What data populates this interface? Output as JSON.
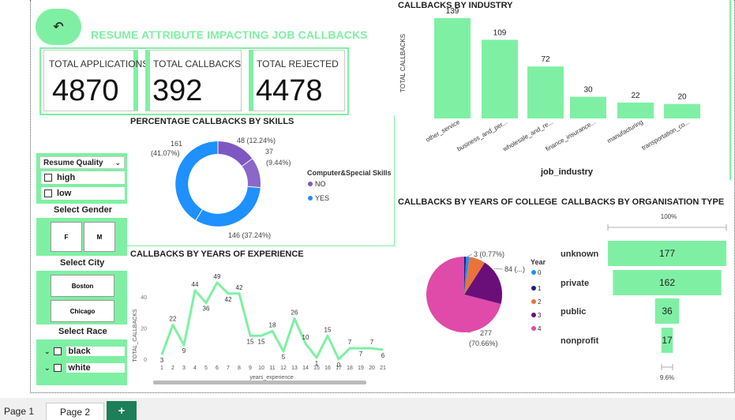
{
  "back_button": {
    "icon": "back-arrow-icon"
  },
  "title": "RESUME ATTRIBUTE IMPACTING JOB  CALLBACKS",
  "kpis": [
    {
      "label": "TOTAL APPLICATIONS",
      "value": "4870"
    },
    {
      "label": "TOTAL CALLBACKS",
      "value": "392"
    },
    {
      "label": "TOTAL REJECTED",
      "value": "4478"
    }
  ],
  "skills_chart": {
    "title": "PERCENTAGE CALLBACKS BY SKILLS",
    "legend_title": "Computer&Special Skills",
    "legend": [
      {
        "name": "NO",
        "color": "#7e57c2"
      },
      {
        "name": "YES",
        "color": "#1e90ff"
      }
    ],
    "labels": [
      "48 (12.24%)",
      "37",
      "(9.44%)",
      "161",
      "(41.07%)",
      "146 (37.24%)"
    ]
  },
  "filters": {
    "resume_quality": {
      "label": "Resume Quality",
      "options": [
        "high",
        "low"
      ]
    },
    "gender": {
      "label": "Select Gender",
      "options": [
        "F",
        "M"
      ]
    },
    "city": {
      "label": "Select City",
      "options": [
        "Boston",
        "Chicago"
      ]
    },
    "race": {
      "label": "Select Race",
      "options": [
        "black",
        "white"
      ]
    }
  },
  "industry_chart": {
    "title": "CALLBACKS BY INDUSTRY",
    "xlabel": "job_industry",
    "ylabel": "TOTAL CALLBACKS"
  },
  "experience_chart": {
    "title": "CALLBACKS BY YEARS OF EXPERIENCE",
    "xlabel": "years_experience",
    "ylabel": "TOTAL_CALLBACKS"
  },
  "college_chart": {
    "title": "CALLBACKS BY YEARS OF COLLEGE",
    "legend_title": "Year",
    "legend": [
      {
        "name": "0",
        "color": "#1e90ff"
      },
      {
        "name": "1",
        "color": "#1a237e"
      },
      {
        "name": "2",
        "color": "#e8743b"
      },
      {
        "name": "3",
        "color": "#6a0f7a"
      },
      {
        "name": "4",
        "color": "#e04aa8"
      }
    ],
    "labels": [
      "3 (0.77%)",
      "84 (...)",
      "277",
      "(70.66%)"
    ]
  },
  "org_chart": {
    "title": "CALLBACKS BY ORGANISATION TYPE",
    "top_label": "100%",
    "bottom_label": "9.6%"
  },
  "chart_data": [
    {
      "type": "bar",
      "title": "CALLBACKS BY INDUSTRY",
      "xlabel": "job_industry",
      "ylabel": "TOTAL CALLBACKS",
      "categories": [
        "other_service",
        "business_and_per...",
        "wholesale_and_re...",
        "finance_insurance...",
        "manufacturing",
        "transportation_co..."
      ],
      "values": [
        139,
        109,
        72,
        30,
        22,
        20
      ],
      "color": "#7ff0a3"
    },
    {
      "type": "line",
      "title": "CALLBACKS BY YEARS OF EXPERIENCE",
      "xlabel": "years_experience",
      "ylabel": "TOTAL_CALLBACKS",
      "x": [
        1,
        2,
        3,
        4,
        5,
        6,
        7,
        8,
        9,
        10,
        11,
        12,
        13,
        14,
        15,
        16,
        17,
        18,
        19,
        20,
        21
      ],
      "y": [
        3,
        22,
        9,
        44,
        36,
        49,
        42,
        42,
        15,
        15,
        18,
        5,
        26,
        10,
        1,
        15,
        0,
        7,
        7,
        7,
        6
      ],
      "yticks": [
        0,
        20,
        40
      ],
      "ylim": [
        0,
        52
      ],
      "color": "#7ff0a3"
    },
    {
      "type": "pie",
      "title": "PERCENTAGE CALLBACKS BY SKILLS",
      "donut": true,
      "series": [
        {
          "name": "NO",
          "values": [
            48,
            37
          ]
        },
        {
          "name": "YES",
          "values": [
            161,
            146
          ]
        }
      ]
    },
    {
      "type": "pie",
      "title": "CALLBACKS BY YEARS OF COLLEGE",
      "categories": [
        "0",
        "2",
        "3",
        "4"
      ],
      "values": [
        3,
        28,
        84,
        277
      ]
    },
    {
      "type": "bar",
      "title": "CALLBACKS BY ORGANISATION TYPE",
      "orientation": "horizontal-funnel",
      "categories": [
        "unknown",
        "private",
        "public",
        "nonprofit"
      ],
      "values": [
        177,
        162,
        36,
        17
      ],
      "color": "#7ff0a3"
    }
  ],
  "tabs": [
    {
      "label": "Page 1"
    },
    {
      "label": "Page 2"
    },
    {
      "label": "+"
    }
  ]
}
